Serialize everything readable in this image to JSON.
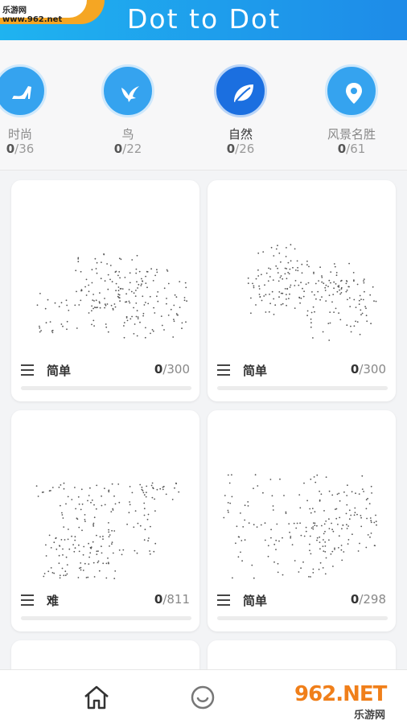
{
  "header": {
    "title": "Dot to Dot"
  },
  "watermark": {
    "top_text": "乐游网 www.962.net",
    "bottom_logo": "962.NET",
    "bottom_sub": "乐游网"
  },
  "categories": [
    {
      "label": "时尚",
      "done": "0",
      "total": "/36",
      "icon": "high-heel-icon"
    },
    {
      "label": "鸟",
      "done": "0",
      "total": "/22",
      "icon": "bird-icon"
    },
    {
      "label": "自然",
      "done": "0",
      "total": "/26",
      "icon": "leaf-icon"
    },
    {
      "label": "风景名胜",
      "done": "0",
      "total": "/61",
      "icon": "location-pin-icon"
    }
  ],
  "cards": [
    {
      "level": "简单",
      "done": "0",
      "total": "/300",
      "progress": 0
    },
    {
      "level": "简单",
      "done": "0",
      "total": "/300",
      "progress": 0
    },
    {
      "level": "难",
      "done": "0",
      "total": "/811",
      "progress": 0
    },
    {
      "level": "简单",
      "done": "0",
      "total": "/298",
      "progress": 0
    }
  ],
  "nav": {
    "items": [
      "home-icon",
      "smiley-icon"
    ]
  },
  "colors": {
    "accent": "#1e8be8",
    "active_category": "#1b6fe0",
    "category": "#35a3ef"
  }
}
